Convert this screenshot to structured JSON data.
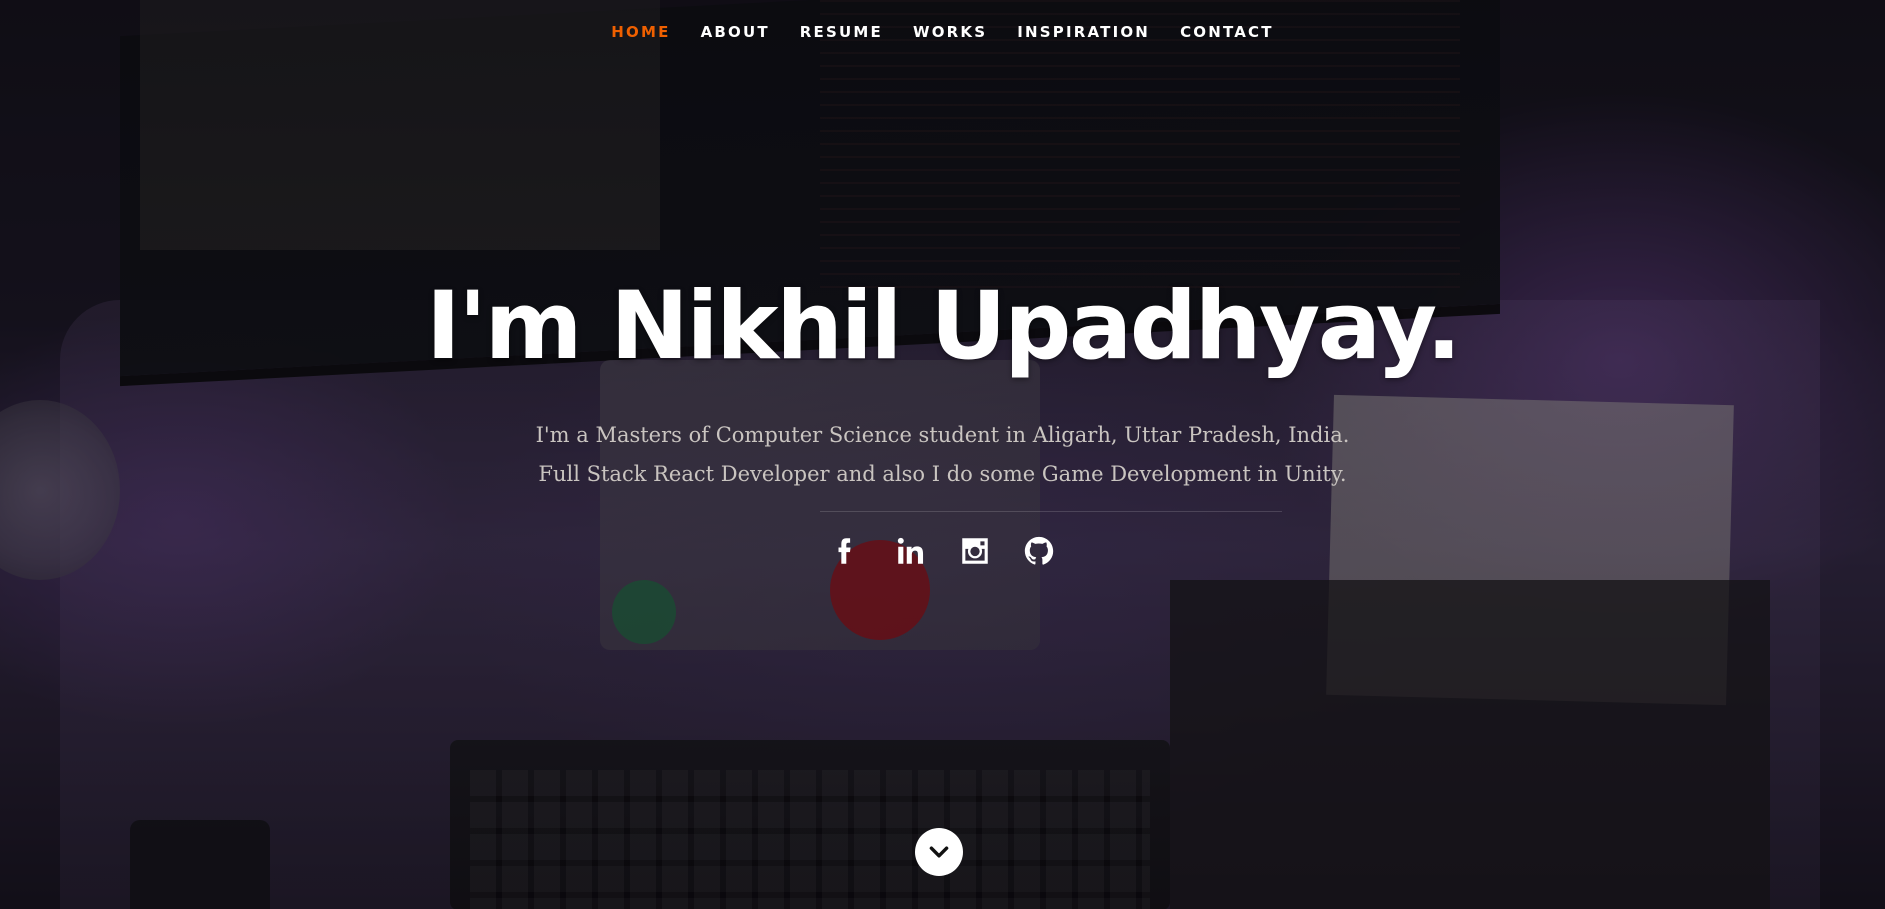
{
  "nav": {
    "items": [
      {
        "label": "Home",
        "active": true
      },
      {
        "label": "About",
        "active": false
      },
      {
        "label": "Resume",
        "active": false
      },
      {
        "label": "Works",
        "active": false
      },
      {
        "label": "Inspiration",
        "active": false
      },
      {
        "label": "Contact",
        "active": false
      }
    ],
    "active_color": "#f06000"
  },
  "banner": {
    "headline": "I'm Nikhil Upadhyay.",
    "line1": "I'm a Masters of Computer Science student in Aligarh, Uttar Pradesh, India.",
    "line2": "Full Stack React Developer and also I do some Game Development in Unity."
  },
  "social": [
    {
      "icon": "facebook-icon"
    },
    {
      "icon": "linkedin-icon"
    },
    {
      "icon": "instagram-icon"
    },
    {
      "icon": "github-icon"
    }
  ],
  "scroll": {
    "icon": "chevron-down-icon"
  }
}
